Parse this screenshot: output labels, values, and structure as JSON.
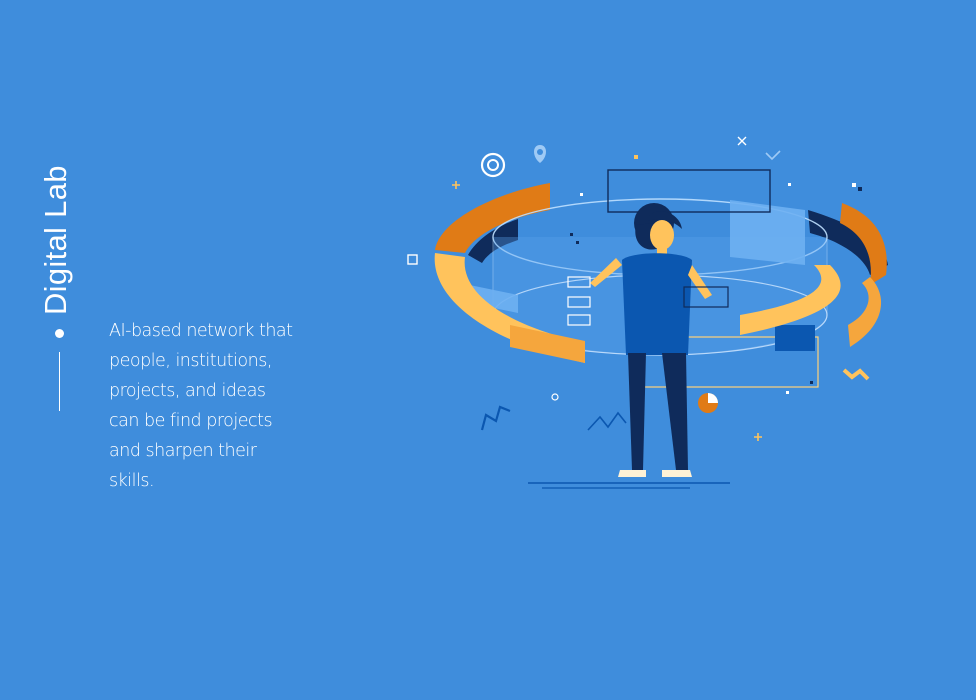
{
  "section": {
    "title": "Digital Lab",
    "description": "AI-based network that people, institutions, projects, and ideas can be find projects and sharpen their skills."
  },
  "illustration": {
    "icon": "person-with-holographic-rings-illustration"
  },
  "colors": {
    "background": "#3f8ddc",
    "text": "#ffffff",
    "accent_orange": "#e07b16",
    "accent_yellow": "#ffc35c",
    "navy": "#0f2b5b",
    "blue_dark": "#0b57b0",
    "blue_light": "#6eb0f2"
  }
}
